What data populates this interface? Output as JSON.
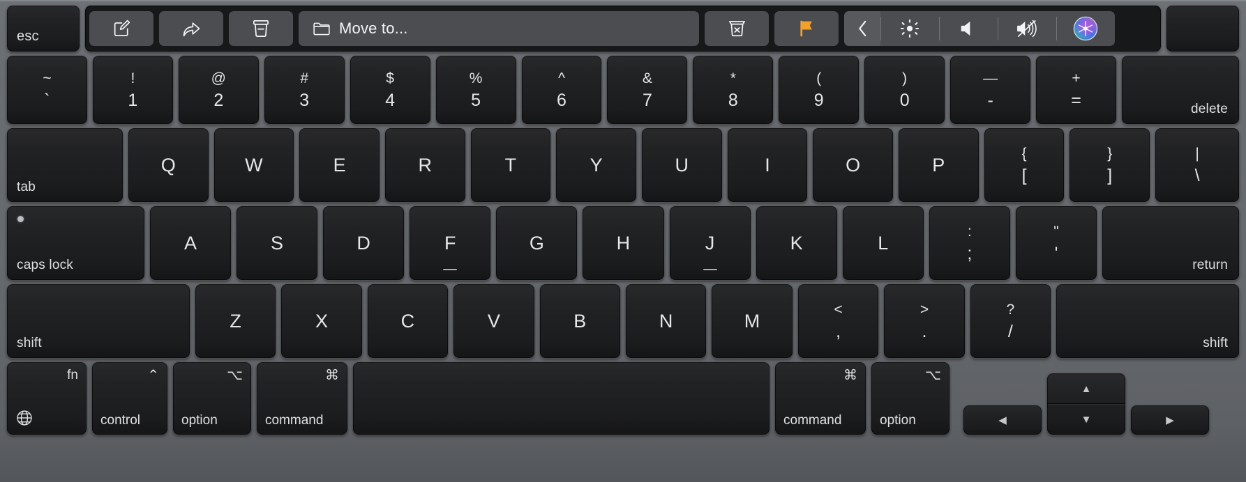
{
  "device": {
    "name": "MacBook Pro keyboard with Touch Bar",
    "layout": "US QWERTY",
    "body_color": "#66696d",
    "key_color": "#1c1d1f",
    "legend_color": "#e6e7e9"
  },
  "touch_bar": {
    "esc_label": "esc",
    "accent_color": "#f3a12a",
    "app_buttons": [
      {
        "name": "compose-button",
        "icon": "compose-icon",
        "label": ""
      },
      {
        "name": "reply-button",
        "icon": "reply-arrow-icon",
        "label": ""
      },
      {
        "name": "archive-button",
        "icon": "archive-box-icon",
        "label": ""
      },
      {
        "name": "move-to-button",
        "icon": "folder-icon",
        "label": "Move to..."
      },
      {
        "name": "delete-button",
        "icon": "trash-x-icon",
        "label": ""
      },
      {
        "name": "flag-button",
        "icon": "flag-icon",
        "label": ""
      }
    ],
    "control_strip": [
      {
        "name": "expand-control-strip",
        "icon": "chevron-left-icon"
      },
      {
        "name": "brightness-button",
        "icon": "brightness-sun-icon"
      },
      {
        "name": "volume-button",
        "icon": "speaker-icon"
      },
      {
        "name": "mute-button",
        "icon": "speaker-mute-icon"
      },
      {
        "name": "siri-button",
        "icon": "siri-icon"
      }
    ]
  },
  "rows": {
    "numbers": [
      {
        "name": "key-backtick",
        "top": "~",
        "bot": "`"
      },
      {
        "name": "key-1",
        "top": "!",
        "bot": "1"
      },
      {
        "name": "key-2",
        "top": "@",
        "bot": "2"
      },
      {
        "name": "key-3",
        "top": "#",
        "bot": "3"
      },
      {
        "name": "key-4",
        "top": "$",
        "bot": "4"
      },
      {
        "name": "key-5",
        "top": "%",
        "bot": "5"
      },
      {
        "name": "key-6",
        "top": "^",
        "bot": "6"
      },
      {
        "name": "key-7",
        "top": "&",
        "bot": "7"
      },
      {
        "name": "key-8",
        "top": "*",
        "bot": "8"
      },
      {
        "name": "key-9",
        "top": "(",
        "bot": "9"
      },
      {
        "name": "key-0",
        "top": ")",
        "bot": "0"
      },
      {
        "name": "key-minus",
        "top": "—",
        "bot": "-"
      },
      {
        "name": "key-equals",
        "top": "+",
        "bot": "="
      }
    ],
    "delete_label": "delete",
    "tab_label": "tab",
    "qwerty": [
      {
        "name": "key-q",
        "glyph": "Q"
      },
      {
        "name": "key-w",
        "glyph": "W"
      },
      {
        "name": "key-e",
        "glyph": "E"
      },
      {
        "name": "key-r",
        "glyph": "R"
      },
      {
        "name": "key-t",
        "glyph": "T"
      },
      {
        "name": "key-y",
        "glyph": "Y"
      },
      {
        "name": "key-u",
        "glyph": "U"
      },
      {
        "name": "key-i",
        "glyph": "I"
      },
      {
        "name": "key-o",
        "glyph": "O"
      },
      {
        "name": "key-p",
        "glyph": "P"
      }
    ],
    "qwerty_tail": [
      {
        "name": "key-bracket-left",
        "top": "{",
        "bot": "["
      },
      {
        "name": "key-bracket-right",
        "top": "}",
        "bot": "]"
      },
      {
        "name": "key-backslash",
        "top": "|",
        "bot": "\\"
      }
    ],
    "caps_label": "caps lock",
    "home": [
      {
        "name": "key-a",
        "glyph": "A",
        "bump": false
      },
      {
        "name": "key-s",
        "glyph": "S",
        "bump": false
      },
      {
        "name": "key-d",
        "glyph": "D",
        "bump": false
      },
      {
        "name": "key-f",
        "glyph": "F",
        "bump": true
      },
      {
        "name": "key-g",
        "glyph": "G",
        "bump": false
      },
      {
        "name": "key-h",
        "glyph": "H",
        "bump": false
      },
      {
        "name": "key-j",
        "glyph": "J",
        "bump": true
      },
      {
        "name": "key-k",
        "glyph": "K",
        "bump": false
      },
      {
        "name": "key-l",
        "glyph": "L",
        "bump": false
      }
    ],
    "home_tail": [
      {
        "name": "key-semicolon",
        "top": ":",
        "bot": ";"
      },
      {
        "name": "key-quote",
        "top": "\"",
        "bot": "'"
      }
    ],
    "return_label": "return",
    "shift_left_label": "shift",
    "zxcv": [
      {
        "name": "key-z",
        "glyph": "Z"
      },
      {
        "name": "key-x",
        "glyph": "X"
      },
      {
        "name": "key-c",
        "glyph": "C"
      },
      {
        "name": "key-v",
        "glyph": "V"
      },
      {
        "name": "key-b",
        "glyph": "B"
      },
      {
        "name": "key-n",
        "glyph": "N"
      },
      {
        "name": "key-m",
        "glyph": "M"
      }
    ],
    "zxcv_tail": [
      {
        "name": "key-comma",
        "top": "<",
        "bot": ","
      },
      {
        "name": "key-period",
        "top": ">",
        "bot": "."
      },
      {
        "name": "key-slash",
        "top": "?",
        "bot": "/"
      }
    ],
    "shift_right_label": "shift",
    "bottom": {
      "fn_label": "fn",
      "fn_icon": "globe-icon",
      "control_symbol": "⌃",
      "control_label": "control",
      "option_left_symbol": "⌥",
      "option_left_label": "option",
      "command_left_symbol": "⌘",
      "command_left_label": "command",
      "space_label": "",
      "command_right_symbol": "⌘",
      "command_right_label": "command",
      "option_right_symbol": "⌥",
      "option_right_label": "option"
    },
    "arrows": {
      "left": "◀",
      "up": "▲",
      "down": "▼",
      "right": "▶"
    }
  }
}
